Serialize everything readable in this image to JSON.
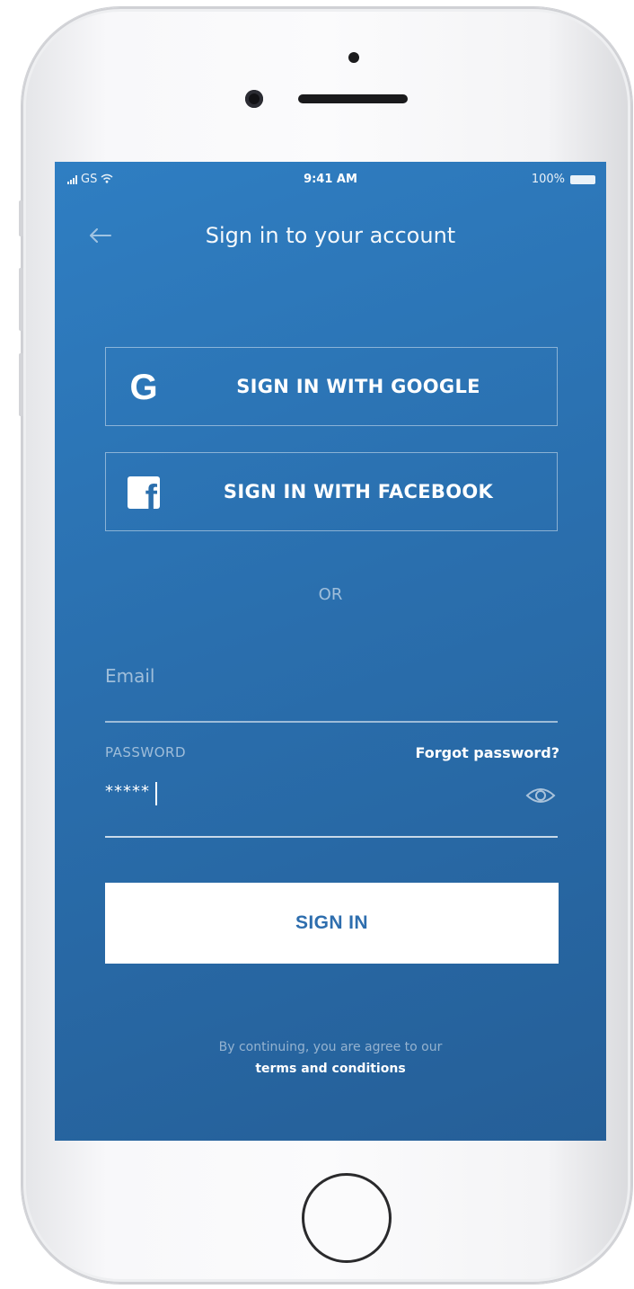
{
  "status_bar": {
    "carrier": "GS",
    "time": "9:41 AM",
    "battery": "100%"
  },
  "header": {
    "title": "Sign in to your account"
  },
  "social": {
    "google_label": "SIGN IN WITH GOOGLE",
    "facebook_label": "SIGN IN WITH FACEBOOK"
  },
  "divider": {
    "or_label": "OR"
  },
  "form": {
    "email_placeholder": "Email",
    "email_value": "",
    "password_label": "PASSWORD",
    "password_value": "*****",
    "forgot_label": "Forgot password?"
  },
  "actions": {
    "signin_label": "SIGN IN"
  },
  "footer": {
    "notice": "By continuing, you are agree to our",
    "terms_label": "terms and conditions"
  },
  "icons": {
    "back": "arrow-left-icon",
    "google": "google-icon",
    "facebook": "facebook-icon",
    "eye": "eye-icon",
    "signal": "signal-icon",
    "wifi": "wifi-icon",
    "battery": "battery-icon"
  },
  "colors": {
    "screen_bg_top": "#2f7ec2",
    "screen_bg_bottom": "#255f98",
    "primary_text_on_white": "#2e6eae"
  }
}
